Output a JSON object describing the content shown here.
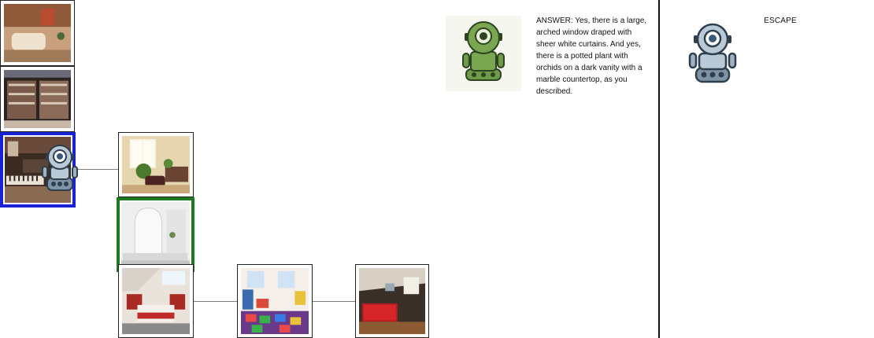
{
  "answer_text": "ANSWER: Yes, there is a large, arched window draped with sheer white curtains. And yes, there is a potted plant with orchids on a dark vanity with a marble countertop, as you described.",
  "escape_label": "ESCAPE",
  "colors": {
    "current_room_border": "#1a22d6",
    "target_room_border": "#1f7a1f",
    "edge": "#808080"
  },
  "rooms": [
    {
      "id": "room-lobby",
      "scene": "lobby reception desk"
    },
    {
      "id": "room-shop",
      "scene": "retail shelves"
    },
    {
      "id": "room-studio",
      "scene": "music studio keyboards",
      "state": "current"
    },
    {
      "id": "room-office",
      "scene": "office with plants"
    },
    {
      "id": "room-bathroom",
      "scene": "white bathroom arched window",
      "state": "target"
    },
    {
      "id": "room-bedroom",
      "scene": "attic bedroom red"
    },
    {
      "id": "room-playroom",
      "scene": "kids playroom"
    },
    {
      "id": "room-gameroom",
      "scene": "game room pool table"
    }
  ]
}
